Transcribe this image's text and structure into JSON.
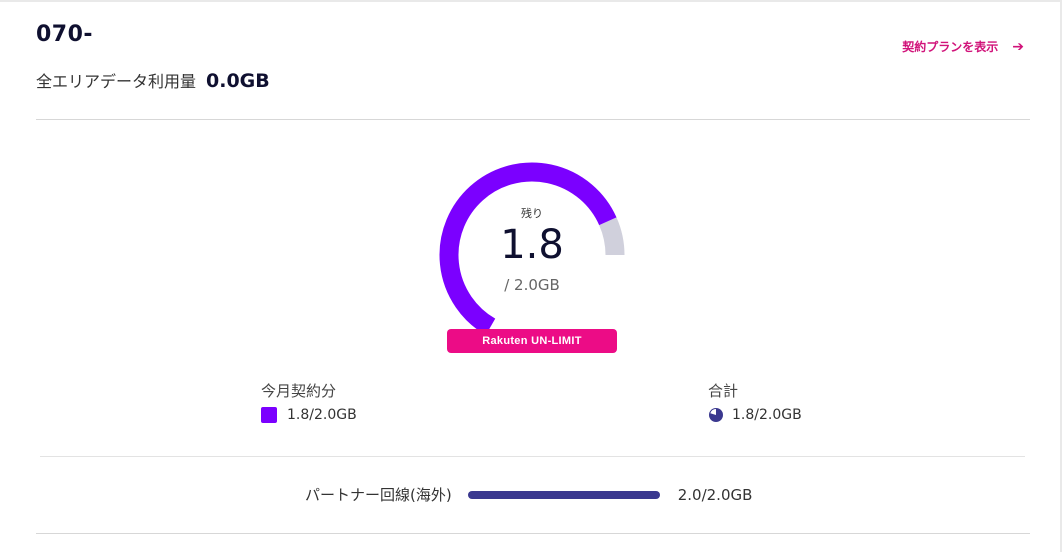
{
  "header": {
    "phone_number": "070-",
    "usage_label": "全エリアデータ利用量",
    "usage_value": "0.0GB",
    "plan_link_label": "契約プランを表示",
    "plan_link_icon": "arrow-right-icon"
  },
  "gauge": {
    "remaining_label": "残り",
    "remaining_value": "1.8",
    "total_label": "/ 2.0GB",
    "remaining_fraction": 0.9,
    "badge_label": "Rakuten UN-LIMIT",
    "colors": {
      "used": "#7b00ff",
      "remaining": "#d0d0dc"
    }
  },
  "stats": {
    "monthly_title": "今月契約分",
    "monthly_value": "1.8/2.0GB",
    "monthly_color": "#7b00ff",
    "total_title": "合計",
    "total_value": "1.8/2.0GB",
    "total_icon": "pie-chart-icon",
    "total_color": "#3a388f"
  },
  "partner": {
    "label": "パートナー回線(海外)",
    "value": "2.0/2.0GB",
    "fraction": 1.0,
    "bar_color": "#3a388f"
  },
  "colors": {
    "accent": "#d1137a",
    "badge": "#ec0c86"
  }
}
